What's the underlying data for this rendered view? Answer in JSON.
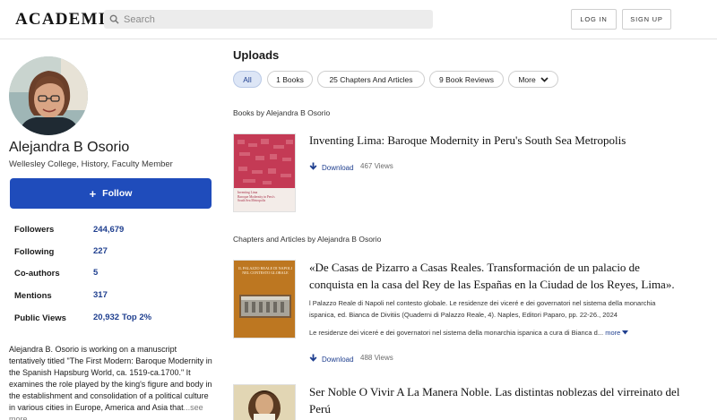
{
  "header": {
    "logo": "ACADEMIA",
    "search_placeholder": "Search",
    "login_label": "LOG IN",
    "signup_label": "SIGN UP"
  },
  "profile": {
    "name": "Alejandra B Osorio",
    "affiliation": "Wellesley College, History, Faculty Member",
    "follow_label": "Follow",
    "stats": [
      {
        "label": "Followers",
        "value": "244,679"
      },
      {
        "label": "Following",
        "value": "227"
      },
      {
        "label": "Co-authors",
        "value": "5"
      },
      {
        "label": "Mentions",
        "value": "317"
      },
      {
        "label": "Public Views",
        "value": "20,932"
      }
    ],
    "top_percent": "Top 2%",
    "bio": "Alejandra B. Osorio is working on a manuscript tentatively titled \"The First Modern: Baroque Modernity in the Spanish Hapsburg World, ca. 1519-ca.1700.\" It examines the role played by the king's figure and body in the establishment and consolidation of a political culture in various cities in Europe, America and Asia that",
    "bio_more": "...see more"
  },
  "uploads": {
    "title": "Uploads",
    "filters": [
      "All",
      "1 Books",
      "25 Chapters And Articles",
      "9 Book Reviews",
      "More"
    ]
  },
  "books": {
    "section_label": "Books by Alejandra B Osorio",
    "items": [
      {
        "title": "Inventing Lima: Baroque Modernity in Peru's South Sea Metropolis",
        "download_label": "Download",
        "views": "467 Views",
        "thumb_lines": [
          "Inventing Lima",
          "Baroque Modernity in Peru's",
          "South Sea Metropolis"
        ]
      }
    ]
  },
  "chapters": {
    "section_label": "Chapters and Articles by Alejandra B Osorio",
    "items": [
      {
        "title_line1": "«De Casas de Pizarro a Casas Reales. Transformación de un palacio de",
        "title_line2": "conquista en la casa del Rey de las Españas en la Ciudad de los Reyes, Lima».",
        "desc_line1": "l Palazzo Reale di Napoli nel contesto globale. Le residenze dei viceré e dei governatori nel sistema della monarchia",
        "desc_line2": "ispanica, ed. Bianca de Divitiis (Quaderni di Palazzo Reale, 4). Naples, Editori Paparo, pp. 22-26., 2024",
        "desc_line3": "Le residenze dei viceré e dei governatori nel sistema della monarchia ispanica a cura di Bianca d...",
        "more_label": "more",
        "download_label": "Download",
        "views": "488 Views",
        "thumb_lines": [
          "IL PALAZZO REALE DI NAPOLI",
          "NEL CONTESTO GLOBALE"
        ]
      },
      {
        "title_line1": "Ser Noble O Vivir A La Manera Noble. Las distintas noblezas del virreinato del",
        "title_line2": "Perú"
      }
    ]
  },
  "colors": {
    "accent": "#1f4cbb",
    "link": "#1f3f8f",
    "chip_active_bg": "#dde6f6"
  }
}
